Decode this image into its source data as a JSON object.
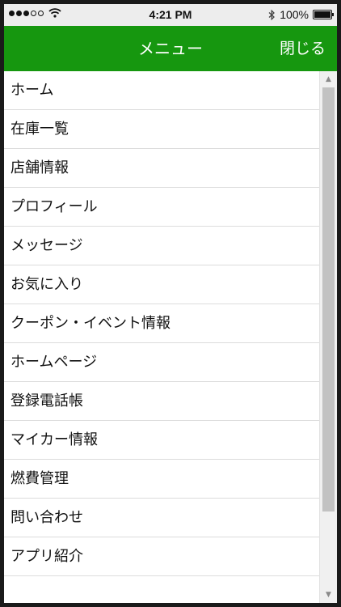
{
  "status_bar": {
    "time": "4:21 PM",
    "battery": "100%",
    "icons": [
      "signal-icon",
      "wifi-icon",
      "bluetooth-icon",
      "battery-icon"
    ]
  },
  "nav": {
    "title": "メニュー",
    "close_label": "閉じる"
  },
  "menu": {
    "items": [
      {
        "label": "ホーム"
      },
      {
        "label": "在庫一覧"
      },
      {
        "label": "店舗情報"
      },
      {
        "label": "プロフィール"
      },
      {
        "label": "メッセージ"
      },
      {
        "label": "お気に入り"
      },
      {
        "label": "クーポン・イベント情報"
      },
      {
        "label": "ホームページ"
      },
      {
        "label": "登録電話帳"
      },
      {
        "label": "マイカー情報"
      },
      {
        "label": "燃費管理"
      },
      {
        "label": "問い合わせ"
      },
      {
        "label": "アプリ紹介"
      }
    ]
  },
  "colors": {
    "nav_background": "#16970f",
    "nav_text": "#ffffff",
    "divider": "#dcdcdc"
  }
}
